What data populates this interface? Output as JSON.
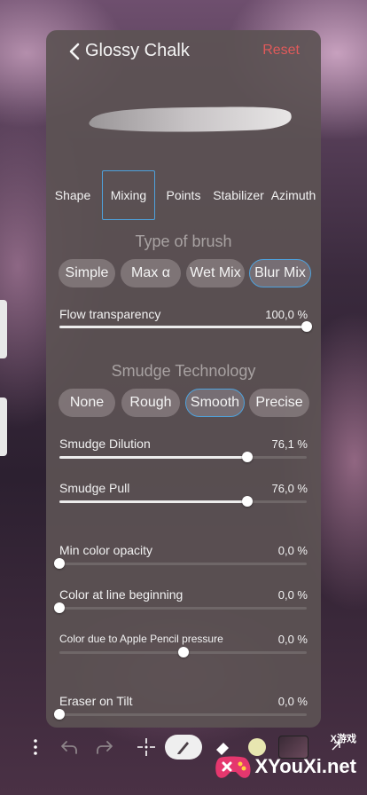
{
  "header": {
    "title": "Glossy Chalk",
    "reset_label": "Reset"
  },
  "tabs": [
    {
      "label": "Shape"
    },
    {
      "label": "Mixing",
      "active": true
    },
    {
      "label": "Points"
    },
    {
      "label": "Stabilizer"
    },
    {
      "label": "Azimuth"
    }
  ],
  "type_of_brush": {
    "title": "Type of brush",
    "options": [
      "Simple",
      "Max α",
      "Wet Mix",
      "Blur Mix"
    ],
    "selected": "Blur Mix"
  },
  "flow": {
    "label": "Flow transparency",
    "value_text": "100,0 %",
    "value": 1.0
  },
  "smudge_technology": {
    "title": "Smudge Technology",
    "options": [
      "None",
      "Rough",
      "Smooth",
      "Precise"
    ],
    "selected": "Smooth"
  },
  "sliders": [
    {
      "label": "Smudge Dilution",
      "value_text": "76,1 %",
      "value": 0.761,
      "filled": true
    },
    {
      "label": "Smudge Pull",
      "value_text": "76,0 %",
      "value": 0.76,
      "filled": true
    },
    {
      "label": "Min color opacity",
      "value_text": "0,0 %",
      "value": 0.0,
      "filled": false
    },
    {
      "label": "Color at line beginning",
      "value_text": "0,0 %",
      "value": 0.0,
      "filled": false
    },
    {
      "label": "Color due to Apple Pencil pressure",
      "value_text": "0,0 %",
      "value": 0.5,
      "filled": false
    },
    {
      "label": "Eraser on Tilt",
      "value_text": "0,0 %",
      "value": 0.0,
      "filled": false
    }
  ],
  "watermark": {
    "text": "XYouXi.net",
    "small": "X游戏"
  },
  "colors": {
    "accent": "#4ea2dd",
    "reset": "#e05a5a",
    "panel": "#5c5254"
  },
  "toolbar_icons": [
    "more-vertical-icon",
    "undo-icon",
    "redo-icon",
    "transform-icon",
    "brush-icon",
    "eraser-icon",
    "color-swatch",
    "layers-thumbnail",
    "expand-icon"
  ]
}
